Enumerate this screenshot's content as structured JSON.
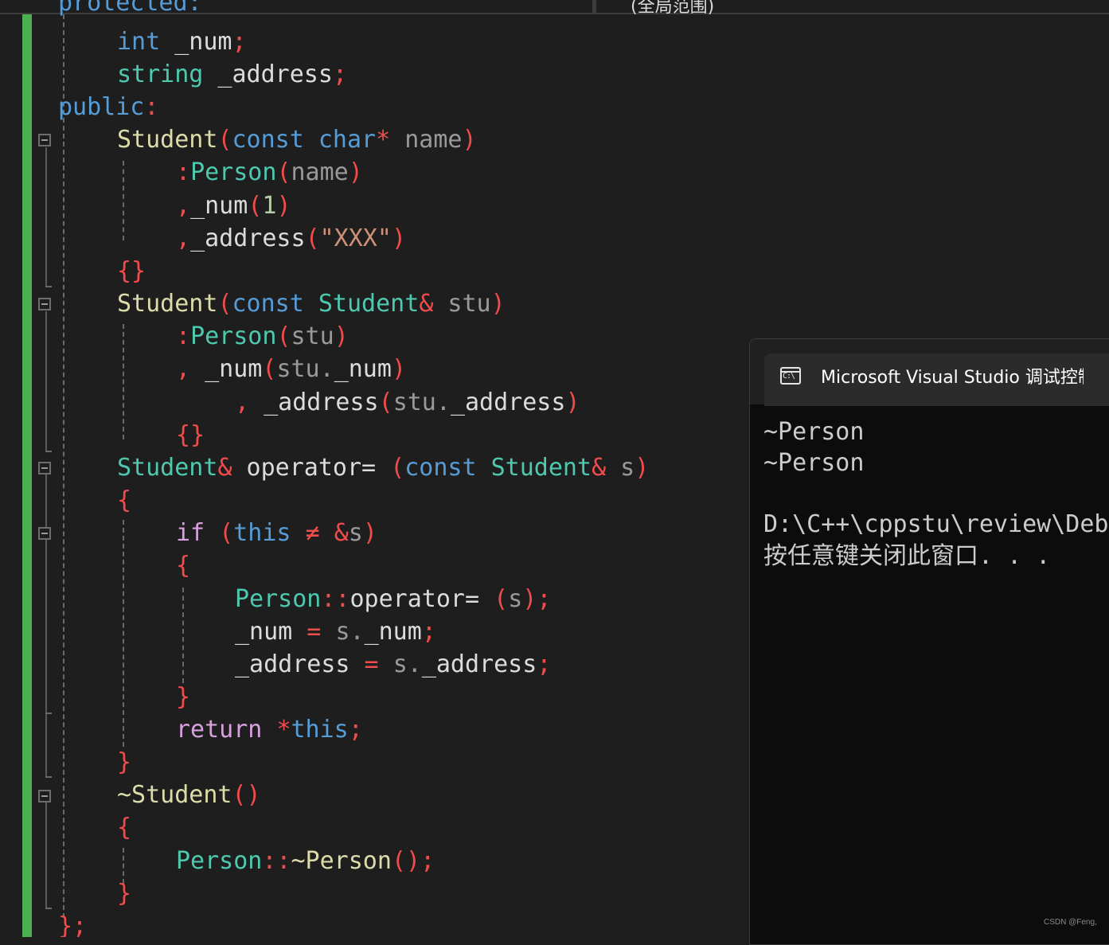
{
  "window_top": {
    "clipped_code": "protected:",
    "clipped_tab": "(全局范围)"
  },
  "code_lines": [
    {
      "indent": 4,
      "tokens": [
        [
          "int",
          "kw"
        ],
        [
          " _num",
          "id"
        ],
        [
          ";",
          "pu"
        ]
      ]
    },
    {
      "indent": 4,
      "tokens": [
        [
          "string",
          "ty"
        ],
        [
          " _address",
          "id"
        ],
        [
          ";",
          "pu"
        ]
      ]
    },
    {
      "indent": 0,
      "tokens": [
        [
          "public",
          "kw"
        ],
        [
          ":",
          "pu"
        ]
      ]
    },
    {
      "indent": 4,
      "tokens": [
        [
          "Student",
          "fn"
        ],
        [
          "(",
          "pu"
        ],
        [
          "const",
          "kw"
        ],
        [
          " ",
          "id"
        ],
        [
          "char",
          "kw"
        ],
        [
          "*",
          "pu"
        ],
        [
          " name",
          "pm"
        ],
        [
          ")",
          "pu"
        ]
      ]
    },
    {
      "indent": 8,
      "tokens": [
        [
          ":",
          "pu"
        ],
        [
          "Person",
          "ty"
        ],
        [
          "(",
          "pu"
        ],
        [
          "name",
          "pm"
        ],
        [
          ")",
          "pu"
        ]
      ]
    },
    {
      "indent": 8,
      "tokens": [
        [
          ",",
          "pu"
        ],
        [
          "_num",
          "id"
        ],
        [
          "(",
          "pu"
        ],
        [
          "1",
          "nu"
        ],
        [
          ")",
          "pu"
        ]
      ]
    },
    {
      "indent": 8,
      "tokens": [
        [
          ",",
          "pu"
        ],
        [
          "_address",
          "id"
        ],
        [
          "(",
          "pu"
        ],
        [
          "\"XXX\"",
          "st"
        ],
        [
          ")",
          "pu"
        ]
      ]
    },
    {
      "indent": 4,
      "tokens": [
        [
          "{}",
          "pu"
        ]
      ]
    },
    {
      "indent": 4,
      "tokens": [
        [
          "Student",
          "fn"
        ],
        [
          "(",
          "pu"
        ],
        [
          "const",
          "kw"
        ],
        [
          " ",
          "id"
        ],
        [
          "Student",
          "ty"
        ],
        [
          "&",
          "pu"
        ],
        [
          " stu",
          "pm"
        ],
        [
          ")",
          "pu"
        ]
      ]
    },
    {
      "indent": 8,
      "tokens": [
        [
          ":",
          "pu"
        ],
        [
          "Person",
          "ty"
        ],
        [
          "(",
          "pu"
        ],
        [
          "stu",
          "pm"
        ],
        [
          ")",
          "pu"
        ]
      ]
    },
    {
      "indent": 8,
      "tokens": [
        [
          ",",
          "pu"
        ],
        [
          " _num",
          "id"
        ],
        [
          "(",
          "pu"
        ],
        [
          "stu",
          "pm"
        ],
        [
          ".",
          "pm"
        ],
        [
          "_num",
          "id"
        ],
        [
          ")",
          "pu"
        ]
      ]
    },
    {
      "indent": 12,
      "tokens": [
        [
          ",",
          "pu"
        ],
        [
          " _address",
          "id"
        ],
        [
          "(",
          "pu"
        ],
        [
          "stu",
          "pm"
        ],
        [
          ".",
          "pm"
        ],
        [
          "_address",
          "id"
        ],
        [
          ")",
          "pu"
        ]
      ]
    },
    {
      "indent": 8,
      "tokens": [
        [
          "{}",
          "pu"
        ]
      ]
    },
    {
      "indent": 4,
      "tokens": [
        [
          "Student",
          "ty"
        ],
        [
          "&",
          "pu"
        ],
        [
          " operator= ",
          "id"
        ],
        [
          "(",
          "pu"
        ],
        [
          "const",
          "kw"
        ],
        [
          " ",
          "id"
        ],
        [
          "Student",
          "ty"
        ],
        [
          "&",
          "pu"
        ],
        [
          " s",
          "pm"
        ],
        [
          ")",
          "pu"
        ]
      ]
    },
    {
      "indent": 4,
      "tokens": [
        [
          "{",
          "pu"
        ]
      ]
    },
    {
      "indent": 8,
      "tokens": [
        [
          "if",
          "ct"
        ],
        [
          " ",
          "id"
        ],
        [
          "(",
          "pu"
        ],
        [
          "this",
          "kw"
        ],
        [
          " ≠ ",
          "pu"
        ],
        [
          "&",
          "pu"
        ],
        [
          "s",
          "pm"
        ],
        [
          ")",
          "pu"
        ]
      ]
    },
    {
      "indent": 8,
      "tokens": [
        [
          "{",
          "pu"
        ]
      ]
    },
    {
      "indent": 12,
      "tokens": [
        [
          "Person",
          "ty"
        ],
        [
          "::",
          "pu"
        ],
        [
          "operator= ",
          "id"
        ],
        [
          "(",
          "pu"
        ],
        [
          "s",
          "pm"
        ],
        [
          ")",
          "pu"
        ],
        [
          ";",
          "pu"
        ]
      ]
    },
    {
      "indent": 12,
      "tokens": [
        [
          "_num",
          "id"
        ],
        [
          " = ",
          "pu"
        ],
        [
          "s",
          "pm"
        ],
        [
          ".",
          "pm"
        ],
        [
          "_num",
          "id"
        ],
        [
          ";",
          "pu"
        ]
      ]
    },
    {
      "indent": 12,
      "tokens": [
        [
          "_address",
          "id"
        ],
        [
          " = ",
          "pu"
        ],
        [
          "s",
          "pm"
        ],
        [
          ".",
          "pm"
        ],
        [
          "_address",
          "id"
        ],
        [
          ";",
          "pu"
        ]
      ]
    },
    {
      "indent": 8,
      "tokens": [
        [
          "}",
          "pu"
        ]
      ]
    },
    {
      "indent": 8,
      "tokens": [
        [
          "return",
          "ct"
        ],
        [
          " ",
          "id"
        ],
        [
          "*",
          "pu"
        ],
        [
          "this",
          "kw"
        ],
        [
          ";",
          "pu"
        ]
      ]
    },
    {
      "indent": 4,
      "tokens": [
        [
          "}",
          "pu"
        ]
      ]
    },
    {
      "indent": 4,
      "tokens": [
        [
          "~Student",
          "fn"
        ],
        [
          "()",
          "pu"
        ]
      ]
    },
    {
      "indent": 4,
      "tokens": [
        [
          "{",
          "pu"
        ]
      ]
    },
    {
      "indent": 8,
      "tokens": [
        [
          "Person",
          "ty"
        ],
        [
          "::",
          "pu"
        ],
        [
          "~Person",
          "fn"
        ],
        [
          "()",
          "pu"
        ],
        [
          ";",
          "pu"
        ]
      ]
    },
    {
      "indent": 4,
      "tokens": [
        [
          "}",
          "pu"
        ]
      ]
    },
    {
      "indent": 0,
      "tokens": [
        [
          "};",
          "pu"
        ]
      ]
    }
  ],
  "console": {
    "title": "Microsoft Visual Studio 调试控制台",
    "icon_text": "C:\\",
    "close_glyph": "×",
    "lines": [
      "~Person",
      "~Person",
      "",
      "D:\\C++\\cppstu\\review\\Debug\\review.exe",
      "按任意键关闭此窗口. . ."
    ]
  },
  "watermark": "CSDN @Feng,",
  "colors": {
    "editor_bg": "#1e1e1e",
    "change_bar": "#4caf50",
    "console_bg": "#0c0c0c",
    "keyword": "#569cd6",
    "type": "#4ec9b0",
    "function": "#dcdcaa",
    "punctuation": "#f14c4c",
    "string": "#ce9178",
    "control": "#d8a0df"
  }
}
